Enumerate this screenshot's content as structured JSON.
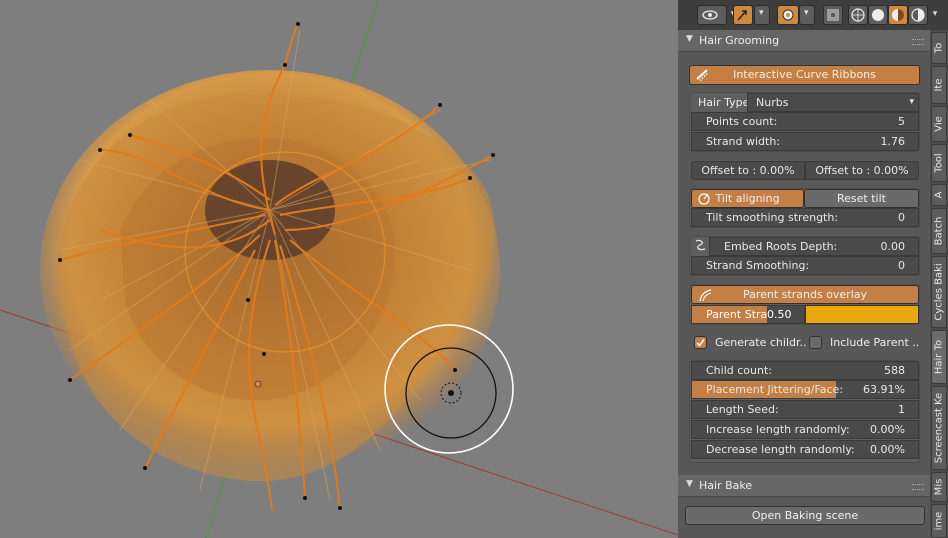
{
  "header": {
    "icons": [
      "viewport-eye-icon",
      "snap-icon",
      "proportional-icon",
      "overlay-icon",
      "wireframe-icon",
      "solid-icon",
      "material-icon",
      "rendered-icon"
    ],
    "accent": "#d0883f"
  },
  "hair_grooming": {
    "title": "Hair Grooming",
    "interactive_button": "Interactive Curve Ribbons",
    "hair_type_label": "Hair Type:",
    "hair_type_value": "Nurbs",
    "points_count_label": "Points count:",
    "points_count_value": "5",
    "strand_width_label": "Strand width:",
    "strand_width_value": "1.76",
    "offset_left": "Offset to : 0.00%",
    "offset_right": "Offset to : 0.00%",
    "tilt_aligning": "Tilt aligning",
    "reset_tilt": "Reset tilt",
    "tilt_smoothing_label": "Tilt smoothing strength:",
    "tilt_smoothing_value": "0",
    "embed_roots_label": "Embed Roots Depth:",
    "embed_roots_value": "0.00",
    "strand_smoothing_label": "Strand Smoothing:",
    "strand_smoothing_value": "0",
    "parent_overlay": "Parent strands overlay",
    "parent_stra_label": "Parent Stra:",
    "parent_stra_value": "0.50",
    "parent_color": "#e8a80e",
    "generate_children": "Generate childr..",
    "generate_children_checked": true,
    "include_parent": "Include Parent ..",
    "include_parent_checked": false,
    "child_count_label": "Child count:",
    "child_count_value": "588",
    "placement_label": "Placement Jittering/Face:",
    "placement_value": "63.91%",
    "placement_fraction": 0.6391,
    "length_seed_label": "Length Seed:",
    "length_seed_value": "1",
    "increase_label": "Increase length randomly:",
    "increase_value": "0.00%",
    "decrease_label": "Decrease length randomly:",
    "decrease_value": "0.00%"
  },
  "hair_bake": {
    "title": "Hair Bake",
    "open_baking": "Open Baking scene"
  },
  "tabs": [
    "To",
    "Ite",
    "Vie",
    "Tool",
    "A",
    "Batch",
    "Cycles Baki",
    "Hair To",
    "Screencast Ke",
    "Mis",
    "ime"
  ]
}
